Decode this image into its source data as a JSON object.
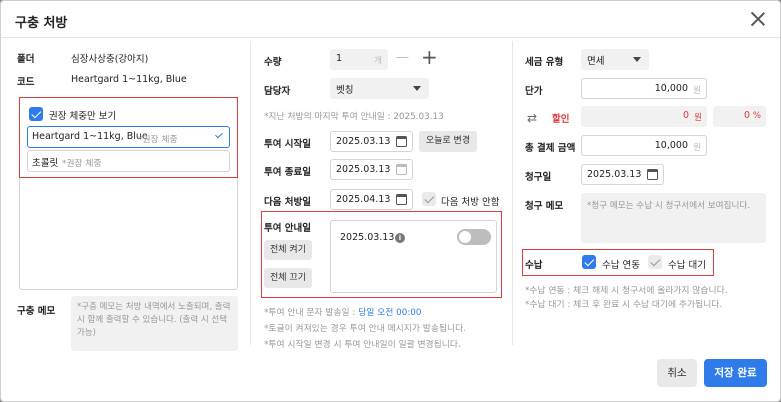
{
  "dialog": {
    "title": "구충 처방"
  },
  "left": {
    "folder_label": "폴더",
    "folder_value": "심장사상충(강아지)",
    "code_label": "코드",
    "code_value": "Heartgard 1~11kg, Blue",
    "only_recommended_label": "권장 체중만 보기",
    "option1_name": "Heartgard 1~11kg, Blue",
    "option1_hint": "*권장 체중",
    "option2_name": "초콜릿",
    "option2_hint": "*권장 체중",
    "memo_label": "구충 메모",
    "memo_placeholder": "*구충 메모는 처방 내역에서 노출되며, 출력 시 함께 출력할 수 있습니다. (출력 시 선택 가능)"
  },
  "middle": {
    "qty_label": "수량",
    "qty_value": "1",
    "qty_unit": "개",
    "minus": "—",
    "plus": "+",
    "manager_label": "담당자",
    "manager_value": "벳칭",
    "last_notice": "*지난 처방의 마지막 투여 안내일 : 2025.03.13",
    "start_label": "투여 시작일",
    "start_value": "2025.03.13",
    "today_btn": "오늘로 변경",
    "end_label": "투여 종료일",
    "end_value": "2025.03.13",
    "next_label": "다음 처방일",
    "next_value": "2025.04.13",
    "no_next": "다음 처방 안함",
    "guide_label": "투여 안내일",
    "all_on": "전체 켜기",
    "all_off": "전체 끄기",
    "guide_date": "2025.03.13",
    "info": "i",
    "sms_prefix": "*투여 안내 문자 발송일 :",
    "sms_time": "당일 오전 00:00",
    "note2": "*토글이 켜져있는 경우 투여 안내 메시지가 발송됩니다.",
    "note3": "*투여 시작일 변경 시 투여 안내일이 일괄 변경됩니다."
  },
  "right": {
    "tax_label": "세금 유형",
    "tax_value": "면세",
    "price_label": "단가",
    "price_value": "10,000",
    "won": "원",
    "discount_label": "할인",
    "discount_won": "0",
    "discount_pct": "0",
    "pct": "%",
    "total_label": "총 결제 금액",
    "total_value": "10,000",
    "bill_label": "청구일",
    "bill_value": "2025.03.13",
    "bill_memo_label": "청구 메모",
    "bill_memo_placeholder": "*청구 메모는 수납 시 청구서에서 보여집니다.",
    "pay_label": "수납",
    "pay_link": "수납 연동",
    "pay_wait": "수납 대기",
    "note1": "*수납 연동 : 체크 해제 시 청구서에 올라가지 않습니다.",
    "note2": "*수납 대기 : 체크 후 완료 시 수납 대기에 추가됩니다."
  },
  "footer": {
    "cancel": "취소",
    "save": "저장 완료"
  },
  "colors": {
    "accent": "#2f7bea",
    "danger": "#e0393e",
    "highlight": "#d64040"
  }
}
